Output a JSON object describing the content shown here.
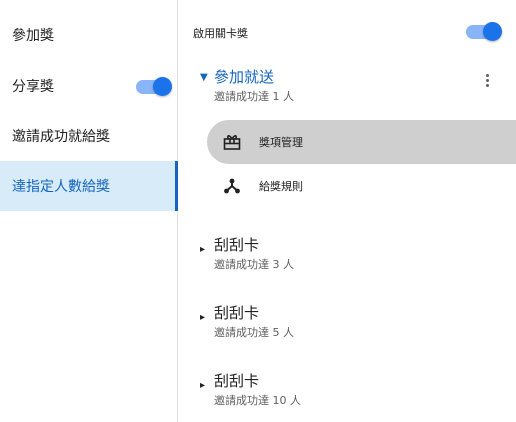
{
  "sidebar": {
    "items": [
      {
        "label": "參加獎"
      },
      {
        "label": "分享獎",
        "toggle_on": true
      },
      {
        "label": "邀請成功就給獎"
      },
      {
        "label": "達指定人數給獎",
        "active": true
      }
    ]
  },
  "main": {
    "header_label": "啟用關卡獎",
    "header_toggle_on": true,
    "sections": [
      {
        "title": "參加就送",
        "subtitle": "邀請成功達 1 人",
        "expanded": true
      },
      {
        "title": "刮刮卡",
        "subtitle": "邀請成功達 3 人",
        "expanded": false
      },
      {
        "title": "刮刮卡",
        "subtitle": "邀請成功達 5 人",
        "expanded": false
      },
      {
        "title": "刮刮卡",
        "subtitle": "邀請成功達 10 人",
        "expanded": false
      }
    ],
    "sub_items": [
      {
        "label": "獎項管理",
        "icon": "gift-box-icon",
        "active": true
      },
      {
        "label": "給獎規則",
        "icon": "network-tree-icon"
      }
    ]
  },
  "colors": {
    "accent": "#1a73e8",
    "active_text": "#1565c0",
    "active_bg": "#d7ecf8",
    "selected_pill": "#cfcfcf"
  }
}
